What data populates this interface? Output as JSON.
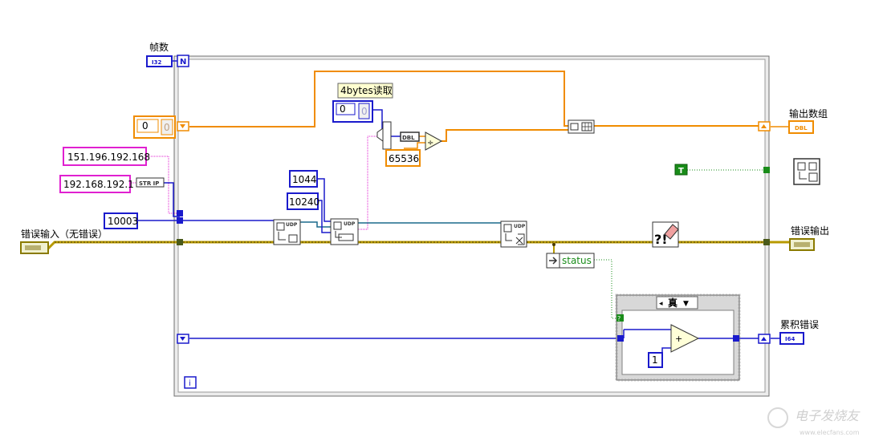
{
  "frames_label": "帧数",
  "i32_tag": "I32",
  "loop_count_terminal": "N",
  "loop_iteration_terminal": "i",
  "output_array_label": "输出数组",
  "output_array_tag": "DBL",
  "error_in_label": "错误输入（无错误）",
  "error_out_label": "错误输出",
  "accum_error_label": "累积错误",
  "i64_tag": "I64",
  "comment_label": "4bytes读取",
  "str_ip_label": "STR IP",
  "ip_constant_1": "151.196.192.168",
  "ip_constant_2": "192.168.192.1",
  "port_constant": "10003",
  "const_1044": "1044",
  "const_10240": "10240",
  "const_65536": "65536",
  "array_index_1": "0",
  "array_index_2": "0",
  "array_value_1": "0",
  "array_value_2": "0",
  "dbl_label": "DBL",
  "divide_symbol": "÷",
  "add_symbol": "+",
  "udp_label": "UDP",
  "true_constant": "T",
  "status_label": "status",
  "case_selector_value": "真",
  "case_selector_arrow": "▼",
  "case_condition_mark": "?",
  "const_one": "1",
  "watermark_text": "电子发烧友",
  "watermark_url": "www.elecfans.com",
  "colors": {
    "orange": "#f08c00",
    "blue": "#1a1acc",
    "pink": "#e020d0",
    "green": "#198c19",
    "error_yellow": "#b89a00",
    "dark": "#333333"
  }
}
